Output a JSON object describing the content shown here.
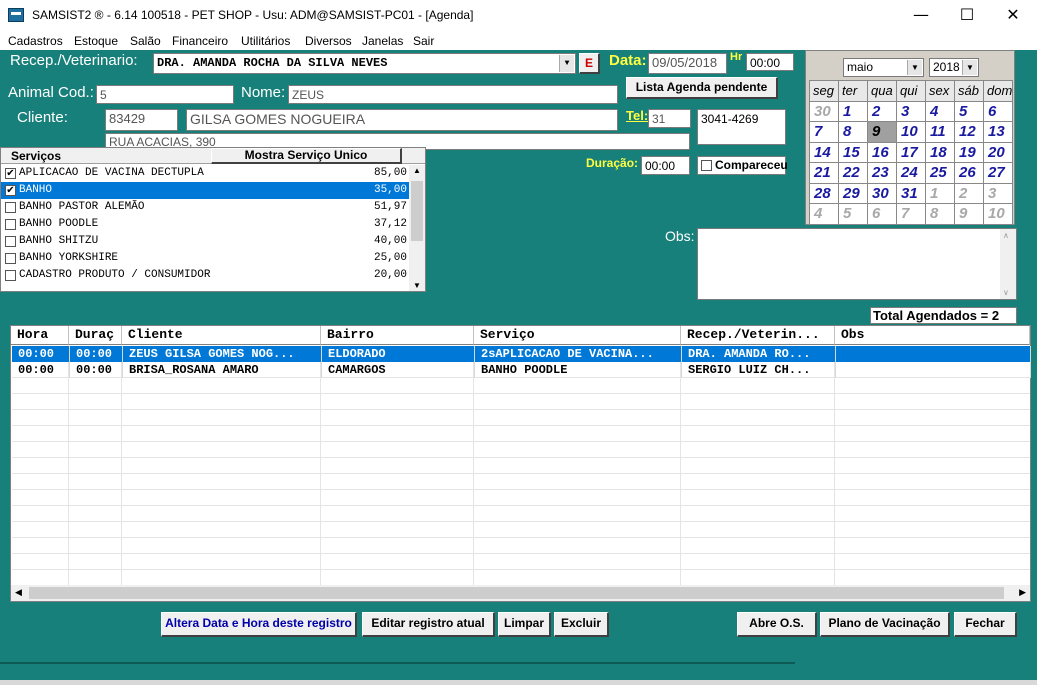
{
  "window": {
    "title": "SAMSIST2 ® - 6.14  100518 - PET SHOP - Usu: ADM@SAMSIST-PC01 - [Agenda]",
    "minimize": "—",
    "maximize": "☐",
    "close": "✕"
  },
  "menu": [
    "Cadastros",
    "Estoque",
    "Salão",
    "Financeiro",
    "Utilitários",
    "Diversos",
    "Janelas",
    "Sair"
  ],
  "form": {
    "recep_label": "Recep./Veterinario:",
    "recep_value": "DRA. AMANDA ROCHA DA SILVA NEVES",
    "e_button": "E",
    "data_label": "Data:",
    "data_value": "09/05/2018",
    "hr_label": "Hr",
    "hr_value": "00:00",
    "animal_label": "Animal Cod.:",
    "animal_value": "5",
    "nome_label": "Nome:",
    "nome_value": "ZEUS",
    "lista_button": "Lista Agenda pendente",
    "cliente_label": "Cliente:",
    "cliente_code": "83429",
    "cliente_name": "GILSA GOMES NOGUEIRA",
    "tel_label": "Tel:",
    "tel_ddd": "31",
    "tel_number": "3041-4269",
    "endereco": "RUA ACACIAS, 390",
    "duracao_label": "Duração:",
    "duracao_value": "00:00",
    "compareceu_label": "Compareceu",
    "obs_label": "Obs:",
    "total_label": "Total Agendados = 2"
  },
  "calendar": {
    "month": "maio",
    "year": "2018",
    "weekdays": [
      "seg",
      "ter",
      "qua",
      "qui",
      "sex",
      "sáb",
      "dom"
    ],
    "days": [
      {
        "d": "30",
        "other": true
      },
      {
        "d": "1"
      },
      {
        "d": "2"
      },
      {
        "d": "3"
      },
      {
        "d": "4"
      },
      {
        "d": "5"
      },
      {
        "d": "6"
      },
      {
        "d": "7"
      },
      {
        "d": "8"
      },
      {
        "d": "9",
        "today": true
      },
      {
        "d": "10"
      },
      {
        "d": "11"
      },
      {
        "d": "12"
      },
      {
        "d": "13"
      },
      {
        "d": "14"
      },
      {
        "d": "15"
      },
      {
        "d": "16"
      },
      {
        "d": "17"
      },
      {
        "d": "18"
      },
      {
        "d": "19"
      },
      {
        "d": "20"
      },
      {
        "d": "21"
      },
      {
        "d": "22"
      },
      {
        "d": "23"
      },
      {
        "d": "24"
      },
      {
        "d": "25"
      },
      {
        "d": "26"
      },
      {
        "d": "27"
      },
      {
        "d": "28"
      },
      {
        "d": "29"
      },
      {
        "d": "30"
      },
      {
        "d": "31"
      },
      {
        "d": "1",
        "other": true
      },
      {
        "d": "2",
        "other": true
      },
      {
        "d": "3",
        "other": true
      },
      {
        "d": "4",
        "other": true
      },
      {
        "d": "5",
        "other": true
      },
      {
        "d": "6",
        "other": true
      },
      {
        "d": "7",
        "other": true
      },
      {
        "d": "8",
        "other": true
      },
      {
        "d": "9",
        "other": true
      },
      {
        "d": "10",
        "other": true
      }
    ]
  },
  "services": {
    "header_label": "Serviços",
    "header_button": "Mostra Serviço Unico",
    "items": [
      {
        "name": "APLICACAO DE VACINA  DECTUPLA",
        "price": "85,00",
        "checked": true,
        "selected": false
      },
      {
        "name": "BANHO",
        "price": "35,00",
        "checked": true,
        "selected": true
      },
      {
        "name": "BANHO PASTOR ALEMÃO",
        "price": "51,97",
        "checked": false,
        "selected": false
      },
      {
        "name": "BANHO POODLE",
        "price": "37,12",
        "checked": false,
        "selected": false
      },
      {
        "name": "BANHO SHITZU",
        "price": "40,00",
        "checked": false,
        "selected": false
      },
      {
        "name": "BANHO YORKSHIRE",
        "price": "25,00",
        "checked": false,
        "selected": false
      },
      {
        "name": "CADASTRO PRODUTO / CONSUMIDOR",
        "price": "20,00",
        "checked": false,
        "selected": false
      }
    ]
  },
  "grid": {
    "columns": [
      "Hora",
      "Duraç",
      "Cliente",
      "Bairro",
      "Serviço",
      "Recep./Veterin...",
      "Obs"
    ],
    "rows": [
      {
        "cells": [
          "00:00",
          "00:00",
          "ZEUS GILSA GOMES NOG...",
          "ELDORADO",
          "2sAPLICACAO DE VACINA...",
          "DRA. AMANDA RO...",
          ""
        ],
        "selected": true
      },
      {
        "cells": [
          "00:00",
          "00:00",
          "BRISA_ROSANA AMARO",
          "CAMARGOS",
          "BANHO POODLE",
          "SERGIO LUIZ CH...",
          ""
        ],
        "selected": false
      }
    ]
  },
  "buttons": {
    "altera": "Altera Data e Hora deste registro",
    "editar": "Editar registro atual",
    "limpar": "Limpar",
    "excluir": "Excluir",
    "abre_os": "Abre O.S.",
    "plano": "Plano de Vacinação",
    "fechar": "Fechar"
  },
  "colors": {
    "background": "#17807a",
    "label_yellow": "#ffff40",
    "selection": "#0078d7",
    "calendar_day": "#1a1aa0"
  }
}
